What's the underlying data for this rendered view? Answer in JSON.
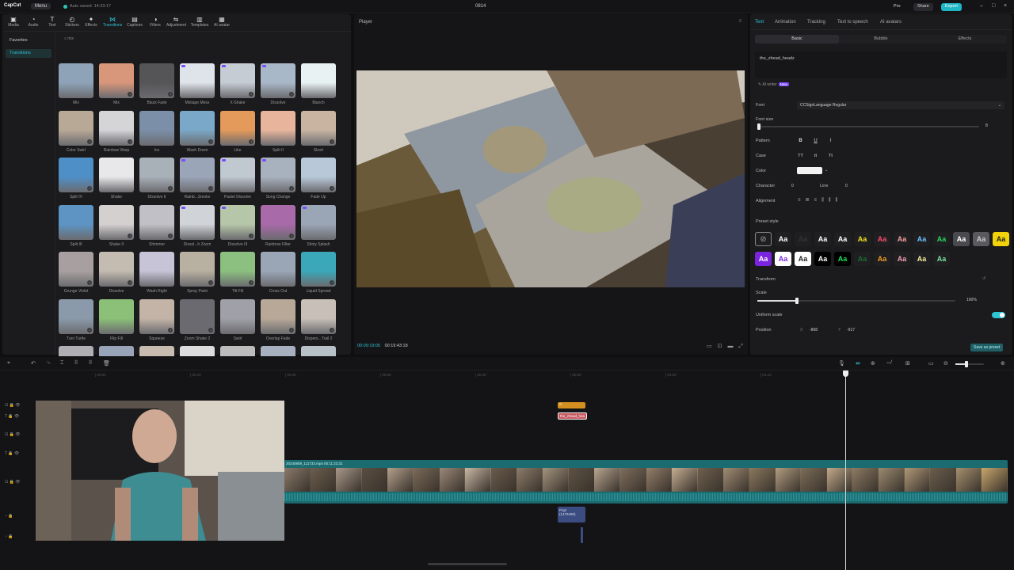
{
  "titlebar": {
    "logo": "CapCut",
    "menu": "Menu",
    "autosave": "Auto saved: 14:23:17",
    "project": "0814",
    "pro": "Pro",
    "share": "Share",
    "export": "Export"
  },
  "toolbar": {
    "items": [
      "Media",
      "Audio",
      "Text",
      "Stickers",
      "Effects",
      "Transitions",
      "Captions",
      "Filters",
      "Adjustment",
      "Templates",
      "AI avatar"
    ],
    "icons": [
      "media-icon",
      "audio-icon",
      "text-icon",
      "stickers-icon",
      "effects-icon",
      "transitions-icon",
      "captions-icon",
      "filters-icon",
      "adjustment-icon",
      "templates-icon",
      "ai-avatar-icon"
    ]
  },
  "sidenav": {
    "favorites": "Favorites",
    "transitions": "Transitions"
  },
  "filter": {
    "label": "mix"
  },
  "transitions": [
    "Mix",
    "Mix",
    "Black Fade",
    "Mixtape Mess",
    "X-Shake",
    "Dissolve",
    "Blanch",
    "Color Swirl",
    "Rainbow Warp",
    "Ice",
    "Wash Down",
    "Like",
    "Split II",
    "Slosh",
    "Split IV",
    "Shake",
    "Dissolve II",
    "Rainb...Smoke",
    "Pastel Dissolve",
    "Song Change",
    "Fade Up",
    "Split III",
    "Shake II",
    "Shimmer",
    "Dissol...h Zoom",
    "Dissolve III",
    "Rainbow Filter",
    "Shiny Splash",
    "Grunge Violet",
    "Dissolve",
    "Wash Right",
    "Spray Paint",
    "Tilt Fill",
    "Cross Out",
    "Liquid Spread",
    "Turn Turtle",
    "Flip Fill",
    "Squeeze",
    "Zoom Shake 2",
    "Swirl",
    "Overlap Fade",
    "Dispers...Trail 2",
    "",
    "",
    "",
    "",
    "",
    "",
    ""
  ],
  "player": {
    "title": "Player",
    "current_time": "00:09:19:05",
    "total_time": "00:19:43:18"
  },
  "rightpanel": {
    "tabs": [
      "Text",
      "Animation",
      "Tracking",
      "Text to speech",
      "AI avatars"
    ],
    "subtabs": [
      "Basic",
      "Bubble",
      "Effects"
    ],
    "text_value": "the_zhead_headz",
    "ai_writer": "AI writer",
    "ai_writer_badge": "New",
    "font_label": "Font",
    "font_value": "CCSignLanguage Regular",
    "font_size_label": "Font size",
    "font_size_value": "8",
    "pattern_label": "Pattern",
    "pattern_b": "B",
    "pattern_u": "U",
    "pattern_i": "I",
    "case_label": "Case",
    "case_upper": "TT",
    "case_lower": "tt",
    "case_title": "Tt",
    "color_label": "Color",
    "character_label": "Character",
    "character_value": "0",
    "line_label": "Line",
    "line_value": "0",
    "alignment_label": "Alignment",
    "preset_label": "Preset style",
    "preset_text": "Aa",
    "transform_label": "Transform",
    "scale_label": "Scale",
    "scale_value": "100%",
    "scale_level": 0.2,
    "uniform_label": "Uniform scale",
    "position_label": "Position",
    "pos_x_label": "X",
    "pos_x": "-868",
    "pos_y_label": "Y",
    "pos_y": "-917",
    "save_preset": "Save as preset"
  },
  "timeline": {
    "ruler": [
      "00:00",
      "00:10",
      "00:20",
      "00:30",
      "00:40",
      "00:50",
      "01:00",
      "01:10"
    ],
    "main_clip_label": "20240809_111733.mp4   00:11:23:31",
    "text_clip": "the_zhead_hea",
    "audio_clip": "Pop! (1479490)"
  }
}
